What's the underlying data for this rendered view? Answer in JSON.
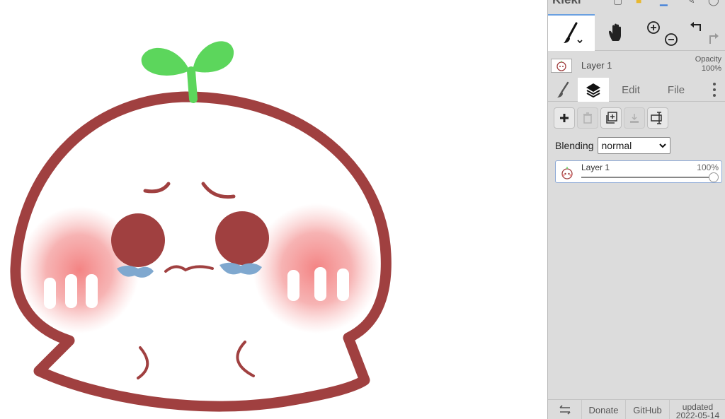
{
  "app": {
    "name": "Kleki"
  },
  "tools": [
    {
      "name": "brush-tool",
      "active": true
    },
    {
      "name": "hand-tool",
      "active": false
    },
    {
      "name": "zoom-tool",
      "active": false
    },
    {
      "name": "undo-redo",
      "active": false
    }
  ],
  "layer_info": {
    "name": "Layer 1",
    "opacity_label": "Opacity",
    "opacity_value": "100%"
  },
  "tabs": [
    {
      "label": "",
      "icon": "brush-icon",
      "active": false
    },
    {
      "label": "",
      "icon": "layers-icon",
      "active": true
    },
    {
      "label": "Edit",
      "active": false
    },
    {
      "label": "File",
      "active": false
    },
    {
      "label": "",
      "icon": "more-vertical-icon",
      "active": false
    }
  ],
  "layer_buttons": [
    "add-layer-icon",
    "delete-layer-icon",
    "duplicate-layer-icon",
    "merge-down-icon",
    "rename-layer-icon"
  ],
  "blending": {
    "label": "Blending",
    "value": "normal"
  },
  "layers": [
    {
      "name": "Layer 1",
      "opacity": "100%",
      "opacity_fraction": 1.0
    }
  ],
  "footer": {
    "swap_icon": "swap-icon",
    "donate": "Donate",
    "github": "GitHub",
    "updated_label": "updated",
    "updated_date": "2022-05-14"
  },
  "colors": {
    "outline": "#a04040",
    "sprout": "#5cd65c",
    "blush": "#f49a9a",
    "tears": "#7fa8cf",
    "panel_bg": "#dcdcdc",
    "accent": "#6aa0e0"
  }
}
